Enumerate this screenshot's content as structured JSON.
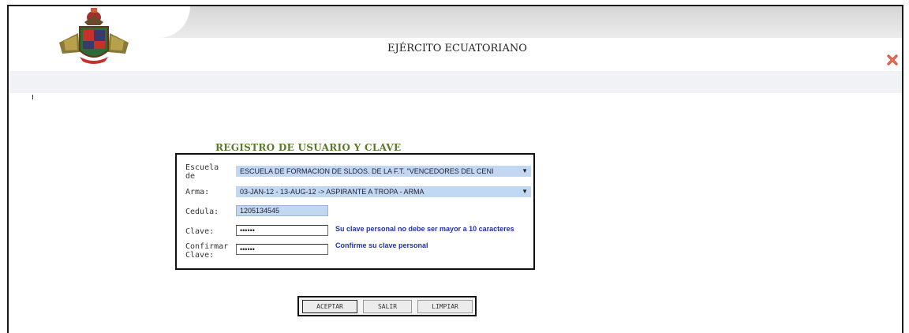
{
  "header": {
    "title": "EJÉRCITO ECUATORIANO",
    "logo_icon": "military-crest-icon",
    "close_icon": "red-x-close-icon"
  },
  "form": {
    "title": "REGISTRO DE USUARIO Y CLAVE",
    "escuela": {
      "label": "Escuela de Formación:",
      "value": "ESCUELA DE FORMACION DE SLDOS. DE LA F.T. \"VENCEDORES DEL CENI"
    },
    "arma": {
      "label": "Arma:",
      "value": "03-JAN-12 - 13-AUG-12 -> ASPIRANTE A TROPA - ARMA"
    },
    "cedula": {
      "label": "Cedula:",
      "value": "1205134545"
    },
    "clave": {
      "label": "Clave:",
      "value": "••••••",
      "hint": "Su clave personal no debe ser mayor a 10 caracteres"
    },
    "confirmar": {
      "label_line1": "Confirmar",
      "label_line2": "Clave:",
      "value": "••••••",
      "hint": "Confirme su clave personal"
    }
  },
  "buttons": {
    "aceptar": "ACEPTAR",
    "salir": "SALIR",
    "limpiar": "LIMPIAR"
  },
  "colors": {
    "field_fill": "#c2d8f2",
    "hint_text": "#2233aa",
    "form_title": "#5a7a2a",
    "close_icon": "#d9432b"
  }
}
